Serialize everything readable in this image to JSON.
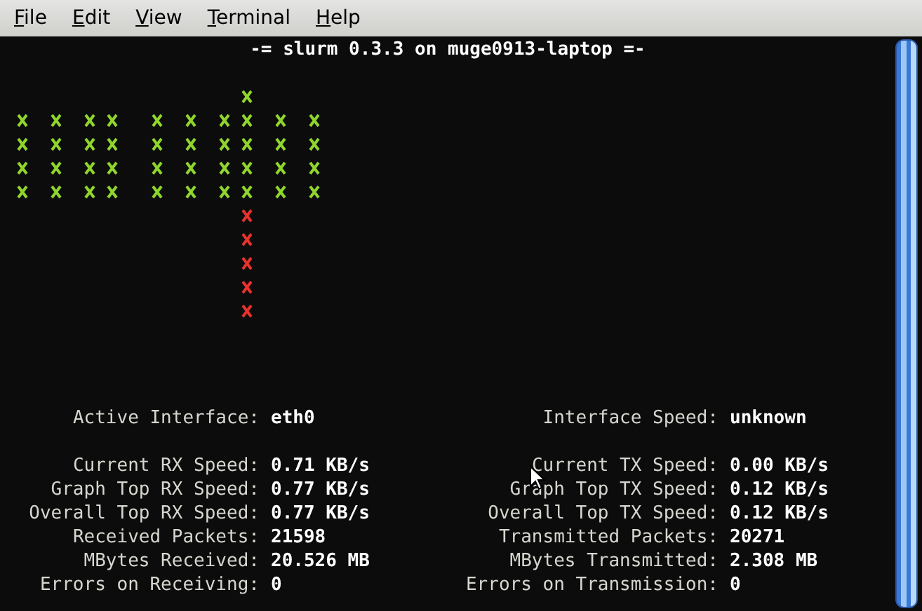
{
  "menu": [
    {
      "label": "File"
    },
    {
      "label": "Edit"
    },
    {
      "label": "View"
    },
    {
      "label": "Terminal"
    },
    {
      "label": "Help"
    }
  ],
  "title": "-= slurm 0.3.3 on muge0913-laptop =-",
  "header": [
    {
      "label": "Active Interface:",
      "value": "eth0"
    },
    {
      "label": "Interface Speed:",
      "value": "unknown"
    }
  ],
  "rx": [
    {
      "label": "Current RX Speed:",
      "value": "0.71 KB/s"
    },
    {
      "label": "Graph Top RX Speed:",
      "value": "0.77 KB/s"
    },
    {
      "label": "Overall Top RX Speed:",
      "value": "0.77 KB/s"
    },
    {
      "label": "Received Packets:",
      "value": "21598"
    },
    {
      "label": "MBytes Received:",
      "value": "20.526 MB"
    },
    {
      "label": "Errors on Receiving:",
      "value": "0"
    }
  ],
  "tx": [
    {
      "label": "Current TX Speed:",
      "value": "0.00 KB/s"
    },
    {
      "label": "Graph Top TX Speed:",
      "value": "0.12 KB/s"
    },
    {
      "label": "Overall Top TX Speed:",
      "value": "0.12 KB/s"
    },
    {
      "label": "Transmitted Packets:",
      "value": "20271"
    },
    {
      "label": "MBytes Transmitted:",
      "value": "2.308 MB"
    },
    {
      "label": "Errors on Transmission:",
      "value": "0"
    }
  ]
}
